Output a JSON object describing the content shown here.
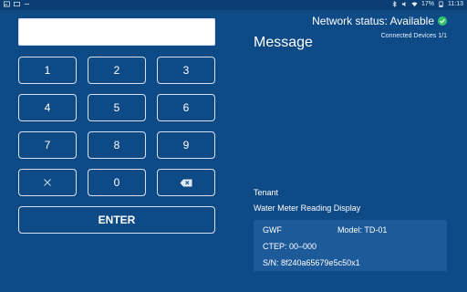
{
  "status_bar": {
    "right_text": "17%",
    "time": "11:13"
  },
  "keypad": {
    "input_value": "",
    "keys": [
      "1",
      "2",
      "3",
      "4",
      "5",
      "6",
      "7",
      "8",
      "9",
      "0"
    ],
    "enter_label": "ENTER"
  },
  "network": {
    "status_text": "Network status: Available",
    "devices_text": "Connected Devices 1/1"
  },
  "message": {
    "title": "Message"
  },
  "tenant": {
    "label": "Tenant",
    "display_label": "Water Meter Reading Display",
    "gwf": "GWF",
    "model": "Model: TD-01",
    "ctep": "CTEP: 00–000",
    "sn": "S/N: 8f240a65679e5c50x1"
  },
  "colors": {
    "background": "#0e4a86",
    "panel": "#1d5a99",
    "status_ok": "#35c46a"
  }
}
